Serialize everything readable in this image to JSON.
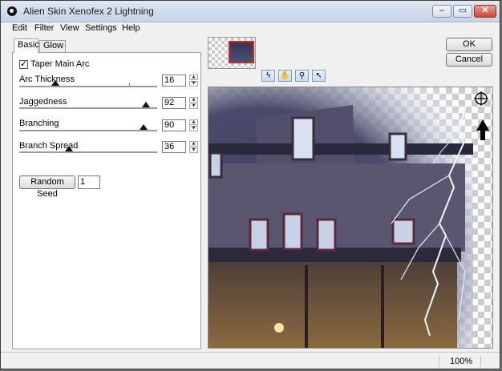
{
  "window": {
    "title": "Alien Skin Xenofex 2 Lightning",
    "min_glyph": "–",
    "max_glyph": "▭",
    "close_glyph": "✕"
  },
  "menu": [
    "Edit",
    "Filter",
    "View",
    "Settings",
    "Help"
  ],
  "tabs": [
    {
      "label": "Basic",
      "active": true
    },
    {
      "label": "Glow",
      "active": false
    }
  ],
  "taper": {
    "label": "Taper Main Arc",
    "checked": true
  },
  "sliders": [
    {
      "label": "Arc Thickness",
      "value": "16",
      "fraction": 0.26
    },
    {
      "label": "Jaggedness",
      "value": "92",
      "fraction": 0.92
    },
    {
      "label": "Branching",
      "value": "90",
      "fraction": 0.9
    },
    {
      "label": "Branch Spread",
      "value": "36",
      "fraction": 0.36
    }
  ],
  "random_seed": {
    "label": "Random Seed",
    "value": "1"
  },
  "buttons": {
    "ok": "OK",
    "cancel": "Cancel"
  },
  "tools": [
    "lightning-tool-icon",
    "hand-tool-icon",
    "zoom-tool-icon",
    "pointer-tool-icon"
  ],
  "spin_glyphs": {
    "up": "▲",
    "down": "▼"
  },
  "preview_icons": [
    "crosshair-target-icon",
    "up-arrow-icon"
  ],
  "status": {
    "zoom": "100%"
  },
  "colors": {
    "sky": "#d9dde6",
    "house": "#3b3f5c",
    "bolt": "#e8efff"
  }
}
